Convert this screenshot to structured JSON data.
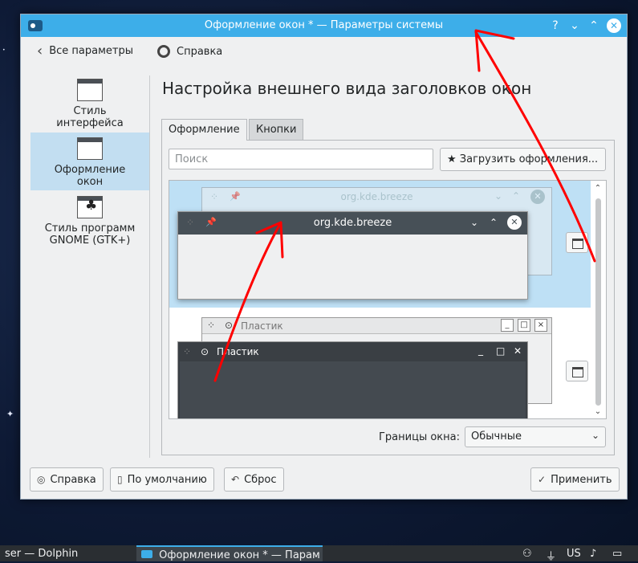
{
  "window": {
    "title": "Оформление окон * — Параметры системы",
    "controls": {
      "help": "?",
      "minimize": "⌄",
      "maximize": "⌃",
      "close": "✕"
    }
  },
  "toolbar": {
    "back_label": "Все параметры",
    "help_label": "Справка"
  },
  "sidebar": {
    "items": [
      {
        "label": "Стиль интерфейса",
        "icon": "window-style-icon",
        "selected": false
      },
      {
        "label": "Оформление окон",
        "icon": "window-decoration-icon",
        "selected": true
      },
      {
        "label": "Стиль программ GNOME (GTK+)",
        "icon": "gnome-icon",
        "selected": false
      }
    ]
  },
  "heading": "Настройка внешнего вида заголовков окон",
  "tabs": [
    {
      "label": "Оформление",
      "active": true
    },
    {
      "label": "Кнопки",
      "active": false
    }
  ],
  "search": {
    "placeholder": "Поиск",
    "value": ""
  },
  "load_button_label": "Загрузить оформления...",
  "decorations": [
    {
      "name": "org.kde.breeze",
      "selected": true
    },
    {
      "name": "Пластик",
      "selected": false
    }
  ],
  "border": {
    "label": "Границы окна:",
    "value": "Обычные"
  },
  "footer": {
    "help": "Справка",
    "defaults": "По умолчанию",
    "reset": "Сброс",
    "apply": "Применить"
  },
  "taskbar": {
    "tasks": [
      {
        "label": "ser — Dolphin",
        "active": false
      },
      {
        "label": "Оформление окон * — Парам",
        "active": true
      }
    ],
    "layout": "US"
  },
  "colors": {
    "accent": "#3daee9",
    "selection": "#bee0f5",
    "annotation": "#ff0000"
  }
}
